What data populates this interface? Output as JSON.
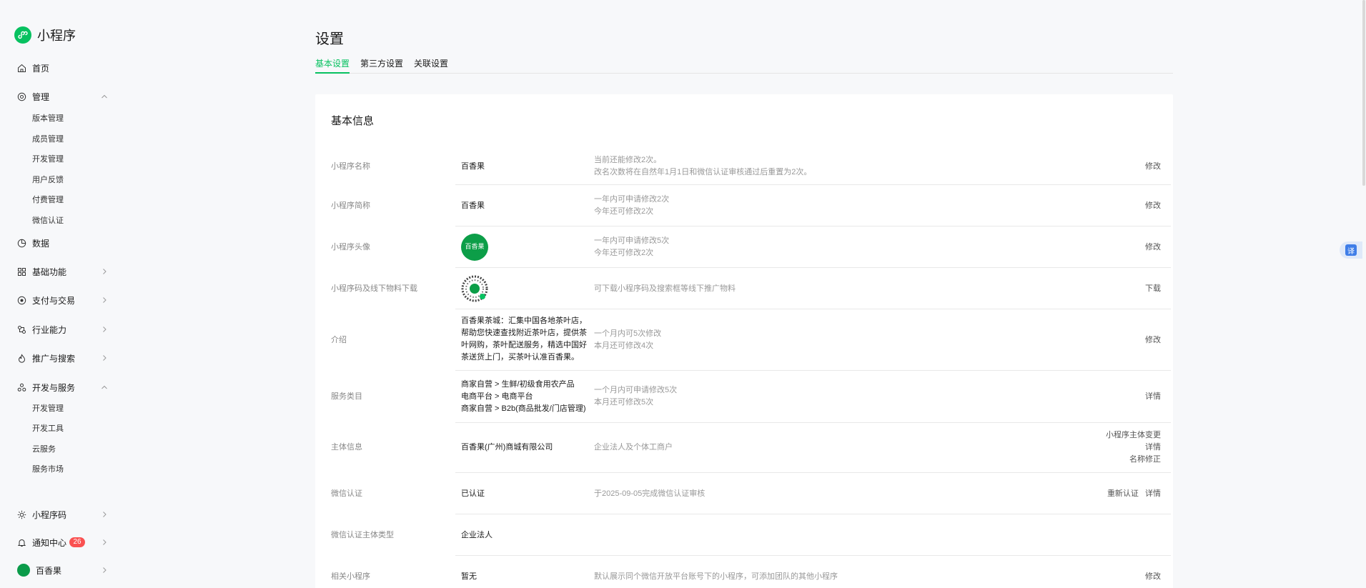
{
  "brand": {
    "name": "小程序",
    "accent": "#07c160"
  },
  "sidebar": {
    "items": [
      {
        "label": "首页",
        "icon": "home-icon"
      },
      {
        "label": "管理",
        "icon": "target-icon",
        "expanded": true,
        "children": [
          "版本管理",
          "成员管理",
          "开发管理",
          "用户反馈",
          "付费管理",
          "微信认证"
        ]
      },
      {
        "label": "数据",
        "icon": "pie-chart-icon"
      },
      {
        "label": "基础功能",
        "icon": "grid-icon"
      },
      {
        "label": "支付与交易",
        "icon": "payment-icon"
      },
      {
        "label": "行业能力",
        "icon": "industry-icon"
      },
      {
        "label": "推广与搜索",
        "icon": "flame-icon"
      },
      {
        "label": "开发与服务",
        "icon": "dev-icon",
        "expanded": true,
        "children": [
          "开发管理",
          "开发工具",
          "云服务",
          "服务市场"
        ]
      }
    ],
    "bottom": [
      {
        "label": "小程序码",
        "icon": "sun-icon"
      },
      {
        "label": "通知中心",
        "icon": "bell-icon",
        "badge": "26"
      },
      {
        "label": "百香果",
        "icon": "account-avatar-icon"
      }
    ]
  },
  "page": {
    "title": "设置",
    "tabs": [
      "基本设置",
      "第三方设置",
      "关联设置"
    ],
    "active_tab": 0
  },
  "card": {
    "title": "基本信息",
    "rows": [
      {
        "label": "小程序名称",
        "value": "百香果",
        "desc": [
          "当前还能修改2次。",
          "改名次数将在自然年1月1日和微信认证审核通过后重置为2次。"
        ],
        "actions": [
          "修改"
        ]
      },
      {
        "label": "小程序简称",
        "value": "百香果",
        "desc": [
          "一年内可申请修改2次",
          "今年还可修改2次"
        ],
        "actions": [
          "修改"
        ]
      },
      {
        "label": "小程序头像",
        "value_avatar_text": "百香果",
        "desc": [
          "一年内可申请修改5次",
          "今年还可修改2次"
        ],
        "actions": [
          "修改"
        ]
      },
      {
        "label": "小程序码及线下物料下载",
        "value_icon": "qr-code-icon",
        "desc": [
          "可下载小程序码及搜索框等线下推广物料"
        ],
        "actions": [
          "下载"
        ]
      },
      {
        "label": "介绍",
        "value_lines": [
          "百香果茶城：汇集中国各地茶叶店，",
          "帮助您快速查找附近茶叶店，提供茶",
          "叶网购，茶叶配送服务，精选中国好",
          "茶送货上门，买茶叶认准百香果。"
        ],
        "desc": [
          "一个月内可5次修改",
          "本月还可修改4次"
        ],
        "actions": [
          "修改"
        ]
      },
      {
        "label": "服务类目",
        "value_lines": [
          "商家自营 > 生鲜/初级食用农产品",
          "电商平台 > 电商平台",
          "商家自营 > B2b(商品批发/门店管理)"
        ],
        "desc": [
          "一个月内可申请修改5次",
          "本月还可修改5次"
        ],
        "actions": [
          "详情"
        ]
      },
      {
        "label": "主体信息",
        "value": "百香果(广州)商城有限公司",
        "desc": [
          "企业法人及个体工商户"
        ],
        "actions": [
          "小程序主体变更",
          "详情",
          "名称修正"
        ]
      },
      {
        "label": "微信认证",
        "value": "已认证",
        "desc": [
          "于2025-09-05完成微信认证审核"
        ],
        "actions": [
          "重新认证",
          "详情"
        ]
      },
      {
        "label": "微信认证主体类型",
        "value": "企业法人",
        "desc": [],
        "actions": []
      },
      {
        "label": "相关小程序",
        "value": "暂无",
        "desc": [
          "默认展示同个微信开放平台账号下的小程序，可添加团队的其他小程序"
        ],
        "actions": [
          "修改"
        ]
      }
    ]
  },
  "floating": {
    "translate_label": "译"
  }
}
